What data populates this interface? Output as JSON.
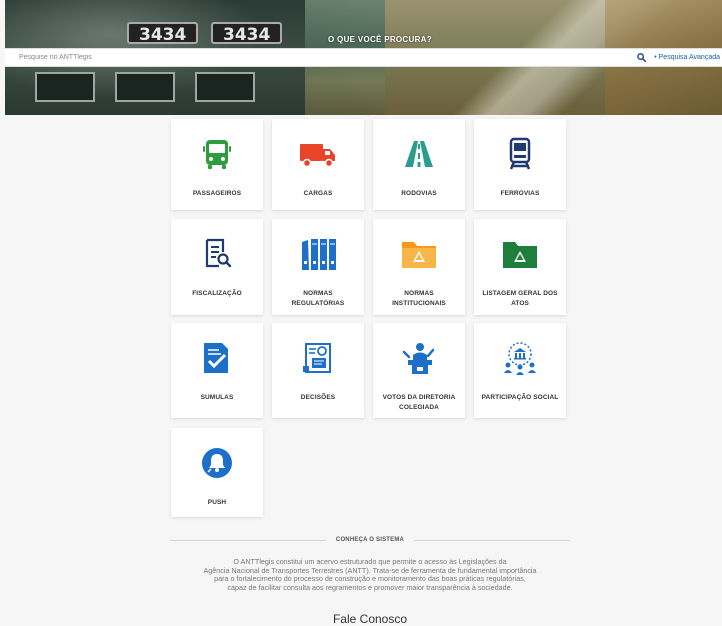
{
  "hero": {
    "title": "O QUE VOCÊ PROCURA?",
    "train_numbers": [
      "3434",
      "3434"
    ]
  },
  "search": {
    "placeholder": "Pesquise no ANTTlegis",
    "advanced_label": "• Pesquisa Avançada"
  },
  "tiles": [
    {
      "label": "PASSAGEIROS",
      "icon": "bus-icon",
      "color": "#2e9c3f"
    },
    {
      "label": "CARGAS",
      "icon": "truck-icon",
      "color": "#e8442a"
    },
    {
      "label": "RODOVIAS",
      "icon": "road-icon",
      "color": "#2a9d8f"
    },
    {
      "label": "FERROVIAS",
      "icon": "train-icon",
      "color": "#1f3a6e"
    },
    {
      "label": "FISCALIZAÇÃO",
      "icon": "inspection-icon",
      "color": "#1f3a6e"
    },
    {
      "label": "NORMAS REGULATÓRIAS",
      "icon": "binders-icon",
      "color": "#1e6fc9"
    },
    {
      "label": "NORMAS INSTITUCIONAIS",
      "icon": "orange-folder-icon",
      "color": "#f39a1d"
    },
    {
      "label": "LISTAGEM GERAL DOS ATOS",
      "icon": "green-folder-icon",
      "color": "#1e7e3c"
    },
    {
      "label": "SUMULAS",
      "icon": "checked-document-icon",
      "color": "#1e6fc9"
    },
    {
      "label": "DECISÕES",
      "icon": "certificate-icon",
      "color": "#1e6fc9"
    },
    {
      "label": "VOTOS DA DIRETORIA COLEGIADA",
      "icon": "speaker-podium-icon",
      "color": "#1e6fc9"
    },
    {
      "label": "PARTICIPAÇÃO SOCIAL",
      "icon": "people-government-icon",
      "color": "#1e6fc9"
    },
    {
      "label": "PUSH",
      "icon": "bell-icon",
      "color": "#1e6fc9"
    }
  ],
  "about": {
    "heading": "CONHEÇA O SISTEMA",
    "lines": [
      "O ANTTlegis constitui um acervo estruturado que permite o acesso às Legislações da",
      "Agência Nacional de Transportes Terrestres (ANTT). Trata-se de ferramenta de fundamental importância",
      "para o fortalecimento do processo de construção e monitoramento das boas práticas regulatórias,",
      "capaz de facilitar consulta aos regramentos e promover maior transparência à sociedade."
    ]
  },
  "contact": {
    "title": "Fale Conosco"
  }
}
